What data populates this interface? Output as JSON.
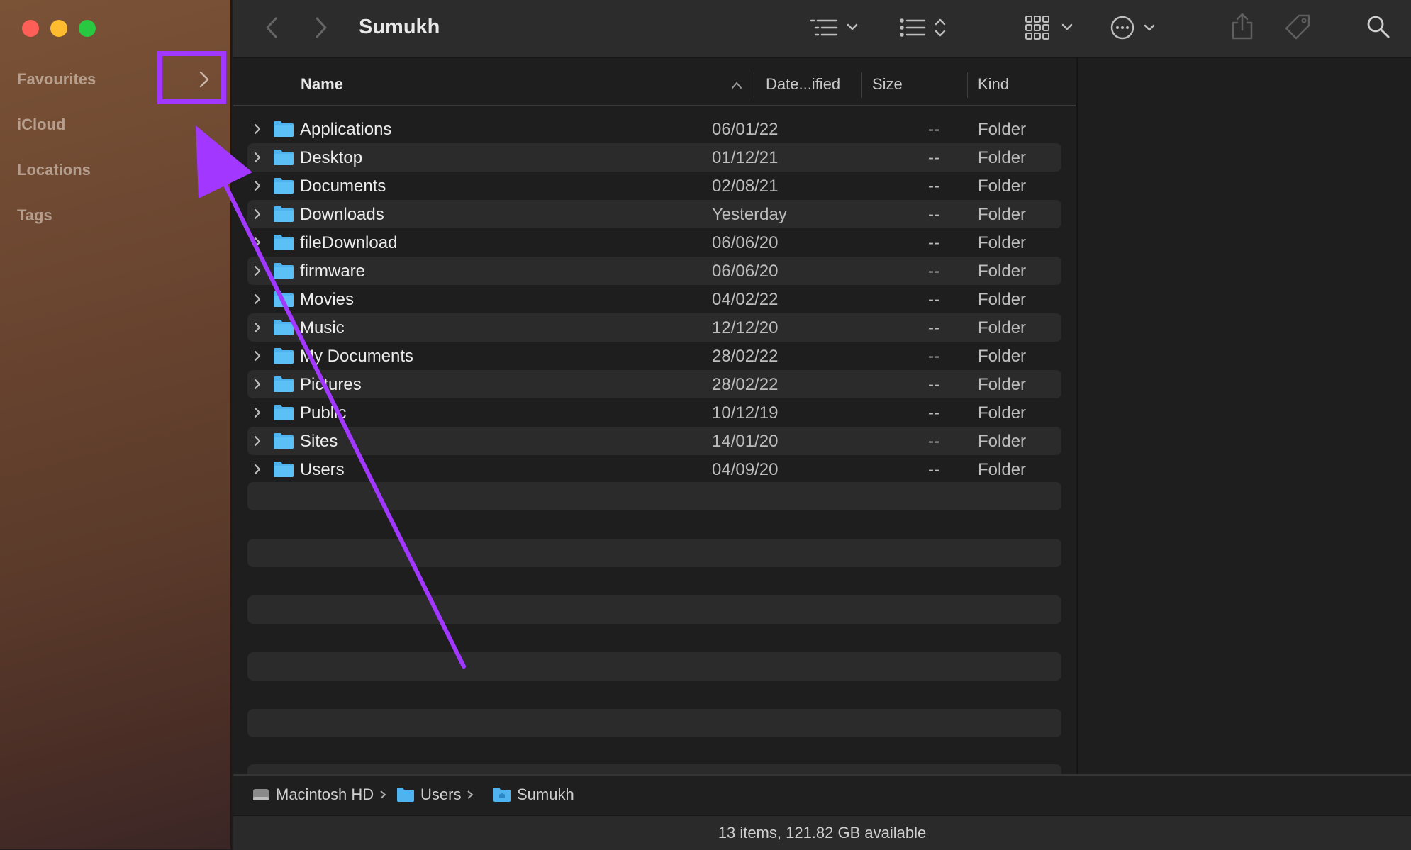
{
  "window": {
    "title": "Sumukh"
  },
  "sidebar": {
    "sections": [
      {
        "label": "Favourites"
      },
      {
        "label": "iCloud"
      },
      {
        "label": "Locations"
      },
      {
        "label": "Tags"
      }
    ]
  },
  "columns": {
    "name": "Name",
    "date": "Date...ified",
    "size": "Size",
    "kind": "Kind"
  },
  "rows": [
    {
      "name": "Applications",
      "date": "06/01/22",
      "size": "--",
      "kind": "Folder"
    },
    {
      "name": "Desktop",
      "date": "01/12/21",
      "size": "--",
      "kind": "Folder"
    },
    {
      "name": "Documents",
      "date": "02/08/21",
      "size": "--",
      "kind": "Folder"
    },
    {
      "name": "Downloads",
      "date": "Yesterday",
      "size": "--",
      "kind": "Folder"
    },
    {
      "name": "fileDownload",
      "date": "06/06/20",
      "size": "--",
      "kind": "Folder"
    },
    {
      "name": "firmware",
      "date": "06/06/20",
      "size": "--",
      "kind": "Folder"
    },
    {
      "name": "Movies",
      "date": "04/02/22",
      "size": "--",
      "kind": "Folder"
    },
    {
      "name": "Music",
      "date": "12/12/20",
      "size": "--",
      "kind": "Folder"
    },
    {
      "name": "My Documents",
      "date": "28/02/22",
      "size": "--",
      "kind": "Folder"
    },
    {
      "name": "Pictures",
      "date": "28/02/22",
      "size": "--",
      "kind": "Folder"
    },
    {
      "name": "Public",
      "date": "10/12/19",
      "size": "--",
      "kind": "Folder"
    },
    {
      "name": "Sites",
      "date": "14/01/20",
      "size": "--",
      "kind": "Folder"
    },
    {
      "name": "Users",
      "date": "04/09/20",
      "size": "--",
      "kind": "Folder"
    }
  ],
  "path": [
    {
      "label": "Macintosh HD",
      "icon": "hard-drive-icon"
    },
    {
      "label": "Users",
      "icon": "folder-icon"
    },
    {
      "label": "Sumukh",
      "icon": "home-folder-icon"
    }
  ],
  "status": "13 items, 121.82 GB available",
  "colors": {
    "annotation": "#a238ff",
    "folder": "#4fb3f0"
  }
}
